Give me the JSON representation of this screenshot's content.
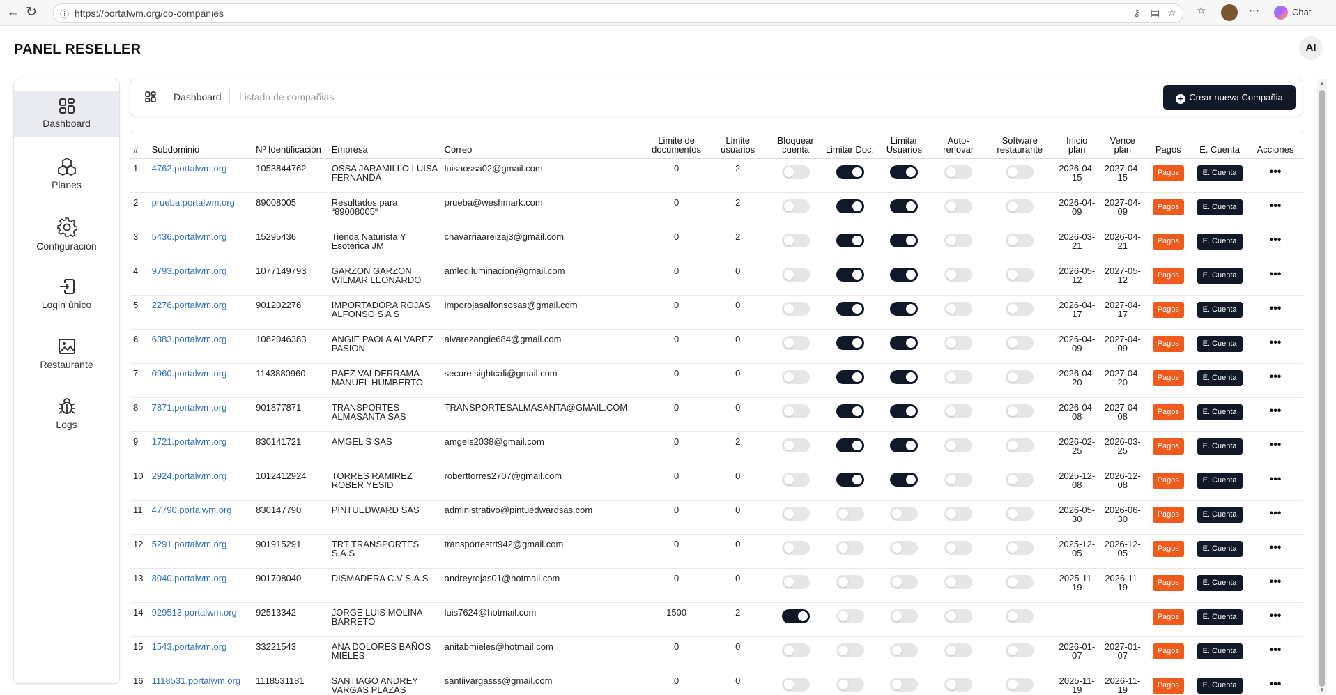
{
  "browser": {
    "url": "https://portalwm.org/co-companies",
    "chat_label": "Chat"
  },
  "app": {
    "title": "PANEL RESELLER",
    "avatar": "AI"
  },
  "sidebar": {
    "items": [
      {
        "label": "Dashboard",
        "icon": "dashboard-grid-icon",
        "active": true
      },
      {
        "label": "Planes",
        "icon": "cubes-icon"
      },
      {
        "label": "Configuración",
        "icon": "gear-icon"
      },
      {
        "label": "Login único",
        "icon": "login-icon"
      },
      {
        "label": "Restaurante",
        "icon": "image-icon"
      },
      {
        "label": "Logs",
        "icon": "bug-icon"
      }
    ]
  },
  "breadcrumb": {
    "home": "Dashboard",
    "current": "Listado de compañias"
  },
  "create_button": "Crear nueva Compañia",
  "table": {
    "headers": {
      "num": "#",
      "subdominio": "Subdominio",
      "nid": "Nº Identificación",
      "empresa": "Empresa",
      "correo": "Correo",
      "limite_docs": "Limite de documentos",
      "limite_users": "Limite usuarios",
      "bloquear": "Bloquear cuenta",
      "limitar_doc": "Limitar Doc.",
      "limitar_usuarios": "Limitar Usuarios",
      "autorenovar": "Auto-renovar",
      "software": "Software restaurante",
      "inicio": "Inicio plan",
      "vence": "Vence plan",
      "pagos": "Pagos",
      "ecuenta": "E. Cuenta",
      "acciones": "Acciones"
    },
    "pagos_label": "Pagos",
    "ecuenta_label": "E. Cuenta",
    "rows": [
      {
        "n": "1",
        "sub": "4762.portalwm.org",
        "nid": "1053844762",
        "emp": "OSSA JARAMILLO LUISA FERNANDA",
        "mail": "luisaossa02@gmail.com",
        "ld": "0",
        "lu": "2",
        "bloq": false,
        "ldoc": true,
        "lusr": true,
        "auto": false,
        "soft": false,
        "ini": "2026-04-15",
        "ven": "2027-04-15"
      },
      {
        "n": "2",
        "sub": "prueba.portalwm.org",
        "nid": "89008005",
        "emp": "Resultados para “89008005“",
        "mail": "prueba@weshmark.com",
        "ld": "0",
        "lu": "2",
        "bloq": false,
        "ldoc": true,
        "lusr": true,
        "auto": false,
        "soft": false,
        "ini": "2026-04-09",
        "ven": "2027-04-09"
      },
      {
        "n": "3",
        "sub": "5436.portalwm.org",
        "nid": "15295436",
        "emp": "Tienda Naturista Y Esotérica JM",
        "mail": "chavarriaareizaj3@gmail.com",
        "ld": "0",
        "lu": "2",
        "bloq": false,
        "ldoc": true,
        "lusr": true,
        "auto": false,
        "soft": false,
        "ini": "2026-03-21",
        "ven": "2026-04-21"
      },
      {
        "n": "4",
        "sub": "9793.portalwm.org",
        "nid": "1077149793",
        "emp": "GARZON GARZON WILMAR LEONARDO",
        "mail": "amlediluminacion@gmail.com",
        "ld": "0",
        "lu": "0",
        "bloq": false,
        "ldoc": true,
        "lusr": true,
        "auto": false,
        "soft": false,
        "ini": "2026-05-12",
        "ven": "2027-05-12"
      },
      {
        "n": "5",
        "sub": "2276.portalwm.org",
        "nid": "901202276",
        "emp": "IMPORTADORA ROJAS ALFONSO S A S",
        "mail": "imporojasalfonsosas@gmail.com",
        "ld": "0",
        "lu": "0",
        "bloq": false,
        "ldoc": true,
        "lusr": true,
        "auto": false,
        "soft": false,
        "ini": "2026-04-17",
        "ven": "2027-04-17"
      },
      {
        "n": "6",
        "sub": "6383.portalwm.org",
        "nid": "1082046383",
        "emp": "ANGIE PAOLA ALVAREZ PASION",
        "mail": "alvarezangie684@gmail.com",
        "ld": "0",
        "lu": "0",
        "bloq": false,
        "ldoc": true,
        "lusr": true,
        "auto": false,
        "soft": false,
        "ini": "2026-04-09",
        "ven": "2027-04-09"
      },
      {
        "n": "7",
        "sub": "0960.portalwm.org",
        "nid": "1143880960",
        "emp": "PÁEZ VALDERRAMA MANUEL HUMBERTO",
        "mail": "secure.sightcali@gmail.com",
        "ld": "0",
        "lu": "0",
        "bloq": false,
        "ldoc": true,
        "lusr": true,
        "auto": false,
        "soft": false,
        "ini": "2026-04-20",
        "ven": "2027-04-20"
      },
      {
        "n": "8",
        "sub": "7871.portalwm.org",
        "nid": "901877871",
        "emp": "TRANSPORTES ALMASANTA SAS",
        "mail": "TRANSPORTESALMASANTA@GMAIL.COM",
        "ld": "0",
        "lu": "0",
        "bloq": false,
        "ldoc": true,
        "lusr": true,
        "auto": false,
        "soft": false,
        "ini": "2026-04-08",
        "ven": "2027-04-08"
      },
      {
        "n": "9",
        "sub": "1721.portalwm.org",
        "nid": "830141721",
        "emp": "AMGEL S SAS",
        "mail": "amgels2038@gmail.com",
        "ld": "0",
        "lu": "2",
        "bloq": false,
        "ldoc": true,
        "lusr": true,
        "auto": false,
        "soft": false,
        "ini": "2026-02-25",
        "ven": "2026-03-25"
      },
      {
        "n": "10",
        "sub": "2924.portalwm.org",
        "nid": "1012412924",
        "emp": "TORRES RAMIREZ ROBER YESID",
        "mail": "roberttorres2707@gmail.com",
        "ld": "0",
        "lu": "0",
        "bloq": false,
        "ldoc": true,
        "lusr": true,
        "auto": false,
        "soft": false,
        "ini": "2025-12-08",
        "ven": "2026-12-08"
      },
      {
        "n": "11",
        "sub": "47790.portalwm.org",
        "nid": "830147790",
        "emp": "PINTUEDWARD SAS",
        "mail": "administrativo@pintuedwardsas.com",
        "ld": "0",
        "lu": "0",
        "bloq": false,
        "ldoc": false,
        "lusr": false,
        "auto": false,
        "soft": false,
        "ini": "2026-05-30",
        "ven": "2026-06-30"
      },
      {
        "n": "12",
        "sub": "5291.portalwm.org",
        "nid": "901915291",
        "emp": "TRT TRANSPORTES S.A.S",
        "mail": "transportestrt942@gmail.com",
        "ld": "0",
        "lu": "0",
        "bloq": false,
        "ldoc": false,
        "lusr": false,
        "auto": false,
        "soft": false,
        "ini": "2025-12-05",
        "ven": "2026-12-05"
      },
      {
        "n": "13",
        "sub": "8040.portalwm.org",
        "nid": "901708040",
        "emp": "DISMADERA C.V S.A.S",
        "mail": "andreyrojas01@hotmail.com",
        "ld": "0",
        "lu": "0",
        "bloq": false,
        "ldoc": false,
        "lusr": false,
        "auto": false,
        "soft": false,
        "ini": "2025-11-19",
        "ven": "2026-11-19"
      },
      {
        "n": "14",
        "sub": "929513.portalwm.org",
        "nid": "92513342",
        "emp": "JORGE LUIS MOLINA BARRETO",
        "mail": "luis7624@hotmail.com",
        "ld": "1500",
        "lu": "2",
        "bloq": true,
        "ldoc": false,
        "lusr": false,
        "auto": false,
        "soft": false,
        "ini": "-",
        "ven": "-"
      },
      {
        "n": "15",
        "sub": "1543.portalwm.org",
        "nid": "33221543",
        "emp": "ANA DOLORES BAÑOS MIELES",
        "mail": "anitabmieles@hotmail.com",
        "ld": "0",
        "lu": "0",
        "bloq": false,
        "ldoc": false,
        "lusr": false,
        "auto": false,
        "soft": false,
        "ini": "2026-01-07",
        "ven": "2027-01-07"
      },
      {
        "n": "16",
        "sub": "1118531.portalwm.org",
        "nid": "1118531181",
        "emp": "SANTIAGO ANDREY VARGAS PLAZAS",
        "mail": "santiivargasss@gmail.com",
        "ld": "0",
        "lu": "0",
        "bloq": false,
        "ldoc": false,
        "lusr": false,
        "auto": false,
        "soft": false,
        "ini": "2025-11-19",
        "ven": "2026-11-19"
      }
    ]
  }
}
